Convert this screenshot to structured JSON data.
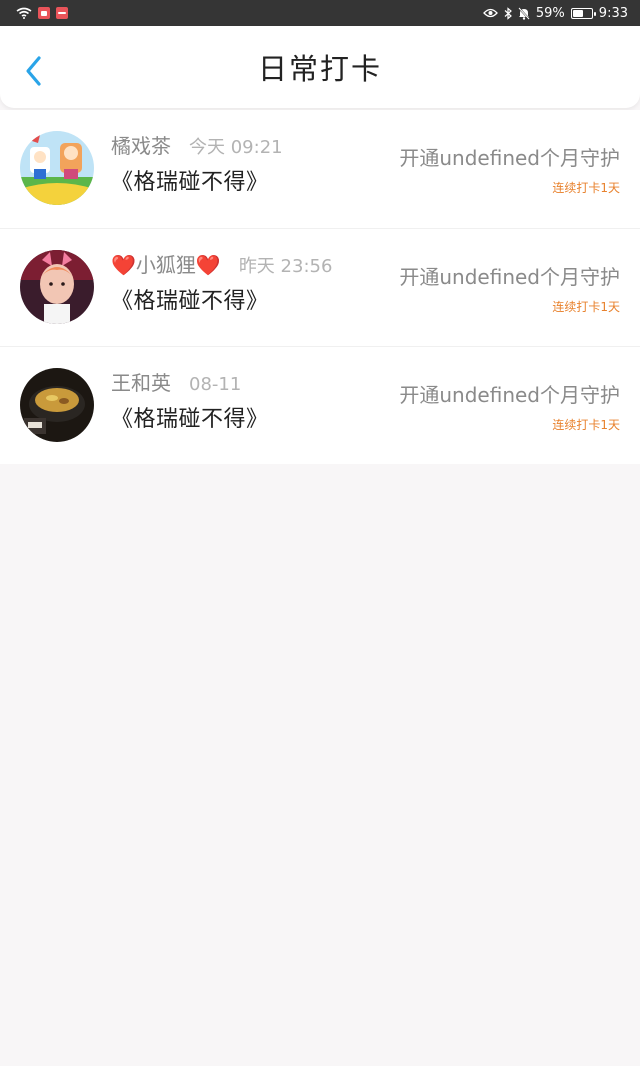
{
  "status_bar": {
    "battery": "59%",
    "time": "9:33",
    "battery_level": 0.59
  },
  "header": {
    "title": "日常打卡"
  },
  "colors": {
    "accent": "#2aa4e8",
    "streak": "#e8822e"
  },
  "items": [
    {
      "name": "橘戏茶",
      "time": "今天 09:21",
      "book": "《格瑞碰不得》",
      "guard": "开通undefined个月守护",
      "streak": "连续打卡1天"
    },
    {
      "name": "❤️小狐狸❤️",
      "time": "昨天 23:56",
      "book": "《格瑞碰不得》",
      "guard": "开通undefined个月守护",
      "streak": "连续打卡1天"
    },
    {
      "name": "王和英",
      "time": "08-11",
      "book": "《格瑞碰不得》",
      "guard": "开通undefined个月守护",
      "streak": "连续打卡1天"
    }
  ]
}
